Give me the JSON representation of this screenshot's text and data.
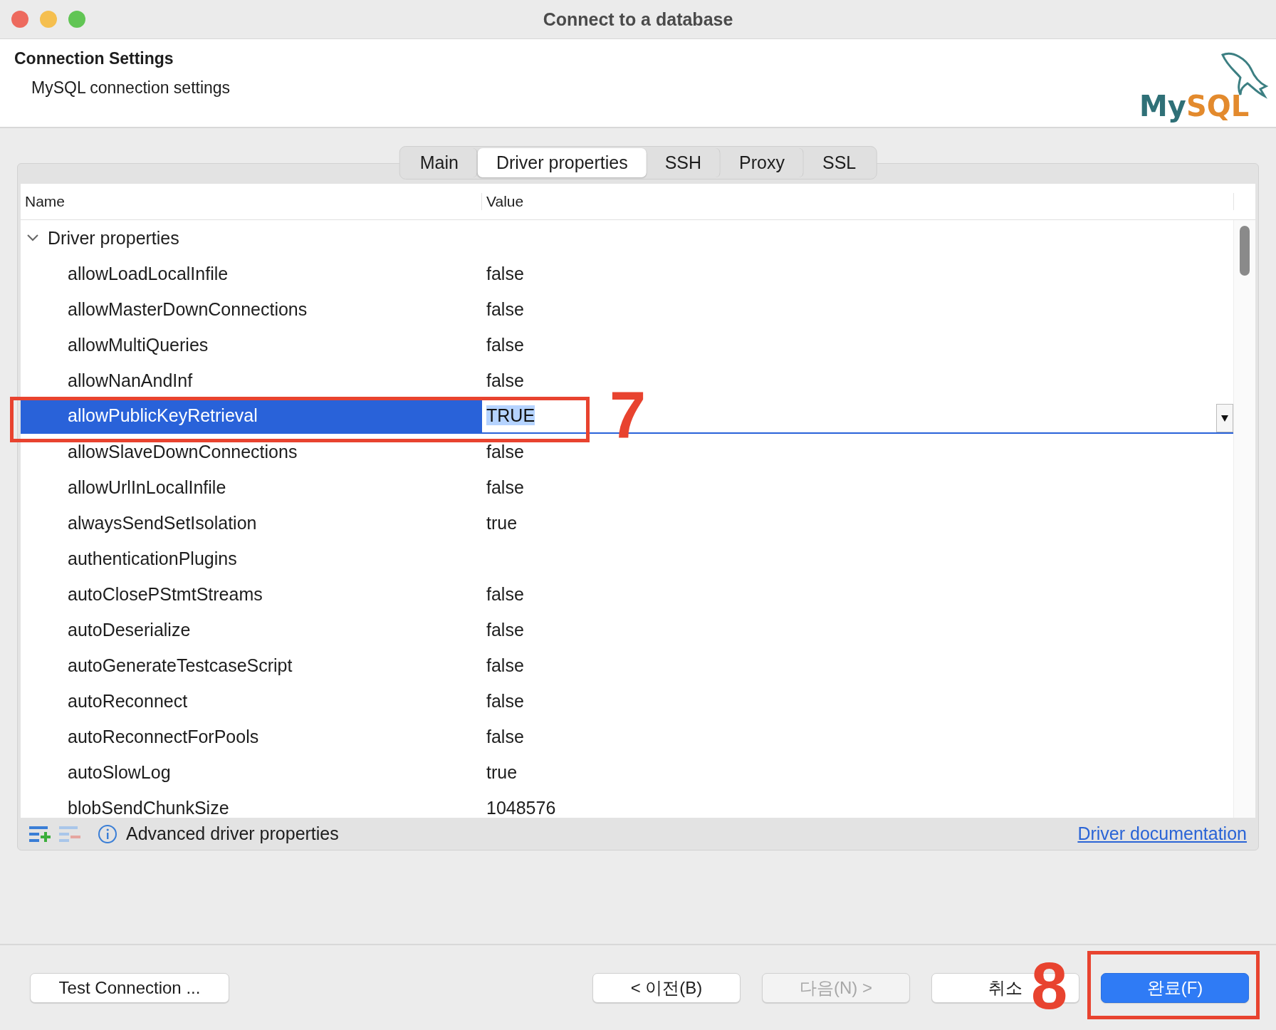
{
  "window": {
    "title": "Connect to a database"
  },
  "header": {
    "title": "Connection Settings",
    "subtitle": "MySQL connection settings",
    "logo": {
      "text_1": "My",
      "text_2": "SQL"
    }
  },
  "tabs": [
    {
      "label": "Main",
      "selected": false
    },
    {
      "label": "Driver properties",
      "selected": true
    },
    {
      "label": "SSH",
      "selected": false
    },
    {
      "label": "Proxy",
      "selected": false
    },
    {
      "label": "SSL",
      "selected": false
    }
  ],
  "table": {
    "columns": [
      "Name",
      "Value"
    ],
    "groups": [
      {
        "name": "Driver properties",
        "expanded": true,
        "children": [
          {
            "name": "allowLoadLocalInfile",
            "value": "false",
            "selected": false
          },
          {
            "name": "allowMasterDownConnections",
            "value": "false",
            "selected": false
          },
          {
            "name": "allowMultiQueries",
            "value": "false",
            "selected": false
          },
          {
            "name": "allowNanAndInf",
            "value": "false",
            "selected": false
          },
          {
            "name": "allowPublicKeyRetrieval",
            "value": "TRUE",
            "selected": true
          },
          {
            "name": "allowSlaveDownConnections",
            "value": "false",
            "selected": false
          },
          {
            "name": "allowUrlInLocalInfile",
            "value": "false",
            "selected": false
          },
          {
            "name": "alwaysSendSetIsolation",
            "value": "true",
            "selected": false
          },
          {
            "name": "authenticationPlugins",
            "selected": false
          },
          {
            "name": "autoClosePStmtStreams",
            "value": "false",
            "selected": false
          },
          {
            "name": "autoDeserialize",
            "value": "false",
            "selected": false
          },
          {
            "name": "autoGenerateTestcaseScript",
            "value": "false",
            "selected": false
          },
          {
            "name": "autoReconnect",
            "value": "false",
            "selected": false
          },
          {
            "name": "autoReconnectForPools",
            "value": "false",
            "selected": false
          },
          {
            "name": "autoSlowLog",
            "value": "true",
            "selected": false
          },
          {
            "name": "blobSendChunkSize",
            "value": "1048576",
            "selected": false
          }
        ]
      }
    ]
  },
  "toolbar": {
    "info": "Advanced driver properties",
    "link": "Driver documentation"
  },
  "buttons": [
    {
      "label": "Test Connection ...",
      "kind": "normal",
      "disabled": false
    },
    {
      "label": "< 이전(B)",
      "kind": "normal",
      "disabled": false
    },
    {
      "label": "다음(N) >",
      "kind": "normal",
      "disabled": true
    },
    {
      "label": "취소",
      "kind": "normal",
      "disabled": false
    },
    {
      "label": "완료(F)",
      "kind": "default",
      "disabled": false
    }
  ],
  "annotations": [
    {
      "label": "7"
    },
    {
      "label": "8"
    }
  ]
}
